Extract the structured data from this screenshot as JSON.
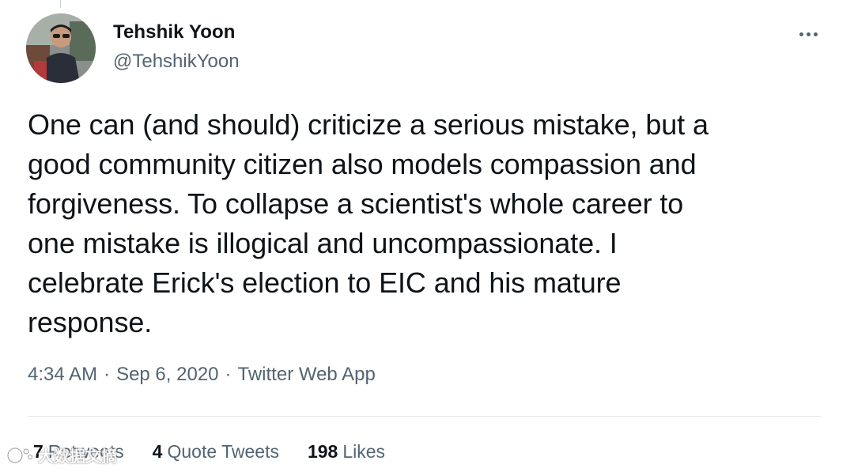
{
  "author": {
    "name": "Tehshik Yoon",
    "handle": "@TehshikYoon",
    "avatar_icon": "user-avatar-photo"
  },
  "more_icon": "more-horizontal-icon",
  "tweet": {
    "text": "One can (and should) criticize a serious mistake, but a\ngood community citizen also models compassion and\nforgiveness. To collapse a scientist's whole career to\none mistake is illogical and uncompassionate. I\ncelebrate Erick's election to EIC and his mature\nresponse."
  },
  "meta": {
    "time": "4:34 AM",
    "separator": "·",
    "date": "Sep 6, 2020",
    "source": "Twitter Web App"
  },
  "stats": {
    "retweets": {
      "count": "7",
      "label": "Retweets"
    },
    "quote_tweets": {
      "count": "4",
      "label": "Quote Tweets"
    },
    "likes": {
      "count": "198",
      "label": "Likes"
    }
  },
  "watermark": {
    "text": "大数据文摘",
    "icon": "watermark-logo-icon"
  },
  "colors": {
    "text_primary": "#0f1419",
    "text_secondary": "#536471",
    "divider": "#e3e7ea",
    "background": "#ffffff"
  }
}
